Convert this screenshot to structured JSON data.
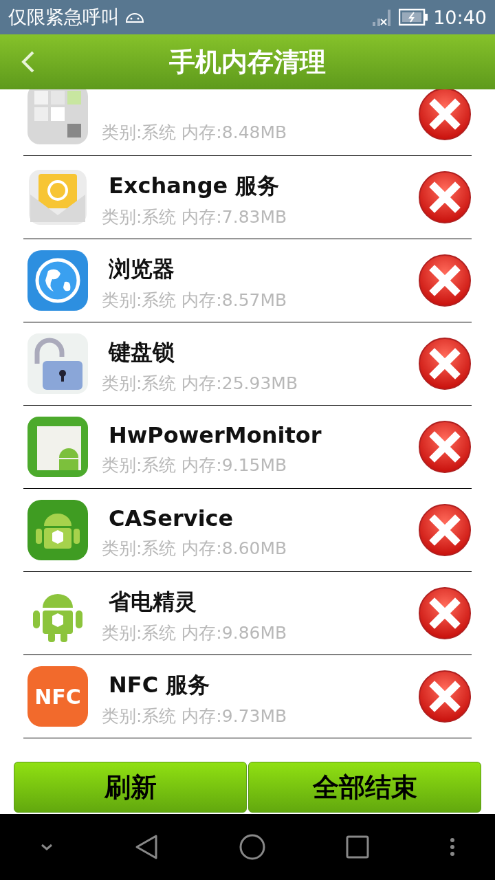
{
  "status_bar": {
    "carrier": "仅限紧急呼叫",
    "time": "10:40"
  },
  "header": {
    "title": "手机内存清理"
  },
  "apps": [
    {
      "info": "类别:系统 内存:8.48MB"
    },
    {
      "name": "Exchange 服务",
      "info": "类别:系统 内存:7.83MB"
    },
    {
      "name": "浏览器",
      "info": "类别:系统 内存:8.57MB"
    },
    {
      "name": "键盘锁",
      "info": "类别:系统 内存:25.93MB"
    },
    {
      "name": "HwPowerMonitor",
      "info": "类别:系统 内存:9.15MB"
    },
    {
      "name": "CAService",
      "info": "类别:系统 内存:8.60MB"
    },
    {
      "name": "省电精灵",
      "info": "类别:系统 内存:9.86MB"
    },
    {
      "name": "NFC 服务",
      "info": "类别:系统 内存:9.73MB",
      "icon_text": "NFC"
    }
  ],
  "buttons": [
    "刷新",
    "全部结束"
  ]
}
